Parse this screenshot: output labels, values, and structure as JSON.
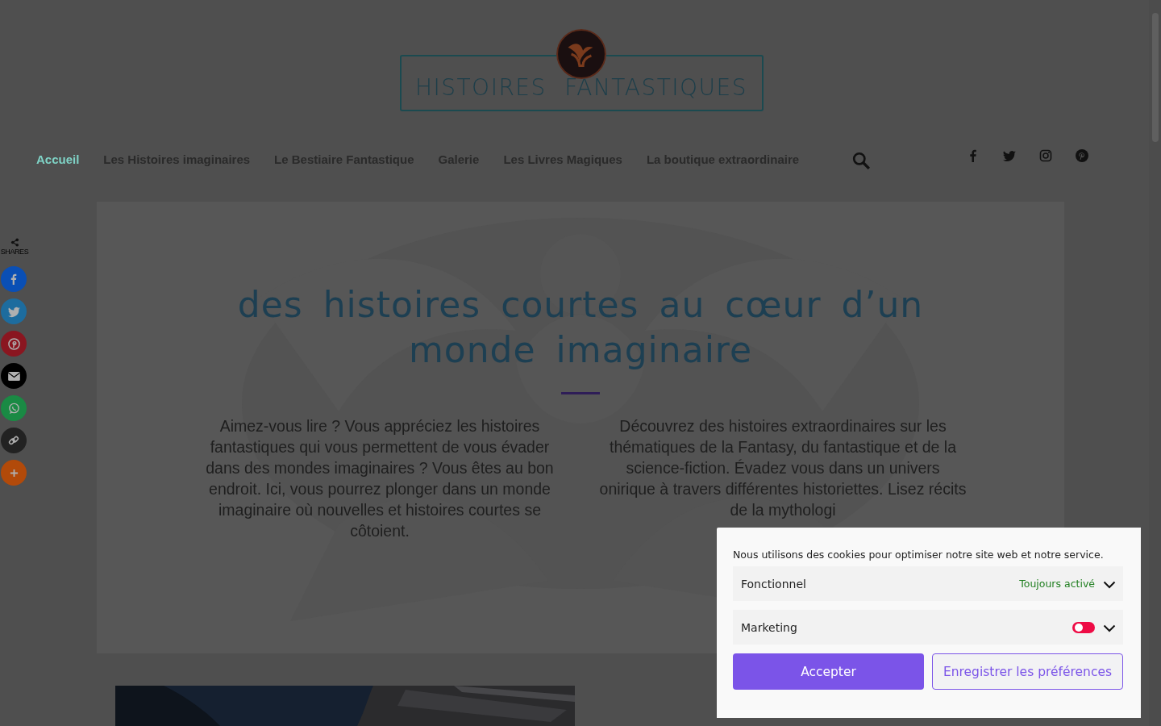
{
  "logo": {
    "title": "HISTOIRES FANTASTIQUES"
  },
  "nav": [
    {
      "label": "Accueil",
      "selected": true
    },
    {
      "label": "Les Histoires imaginaires",
      "selected": false
    },
    {
      "label": "Le Bestiaire Fantastique",
      "selected": false
    },
    {
      "label": "Galerie",
      "selected": false
    },
    {
      "label": "Les Livres Magiques",
      "selected": false
    },
    {
      "label": "La boutique extraordinaire",
      "selected": false
    }
  ],
  "share_bar": {
    "label": "SHARES"
  },
  "hero": {
    "title": "des histoires courtes au cœur d’un monde imaginaire",
    "paragraphs": [
      "Aimez-vous lire ? Vous appréciez les histoires fantastiques qui vous permettent de vous évader dans des mondes imaginaires ? Vous êtes au bon endroit. Ici, vous pourrez plonger dans un monde imaginaire où nouvelles et histoires courtes se côtoient.",
      "Découvrez des histoires extraordinaires sur les thématiques de la Fantasy, du fantastique et de la science-fiction. Évadez vous dans un univers onirique à travers différentes historiettes. Lisez récits de la mythologi"
    ]
  },
  "cookie_banner": {
    "message": "Nous utilisons des cookies pour optimiser notre site web et notre service.",
    "categories": [
      {
        "label": "Fonctionnel",
        "kind": "always",
        "status": "Toujours activé",
        "expanded": false
      },
      {
        "label": "Marketing",
        "kind": "toggle",
        "on": false,
        "expanded": false
      }
    ],
    "buttons": [
      {
        "label": "Accepter",
        "kind": "primary"
      },
      {
        "label": "Enregistrer les préférences",
        "kind": "secondary"
      }
    ]
  }
}
